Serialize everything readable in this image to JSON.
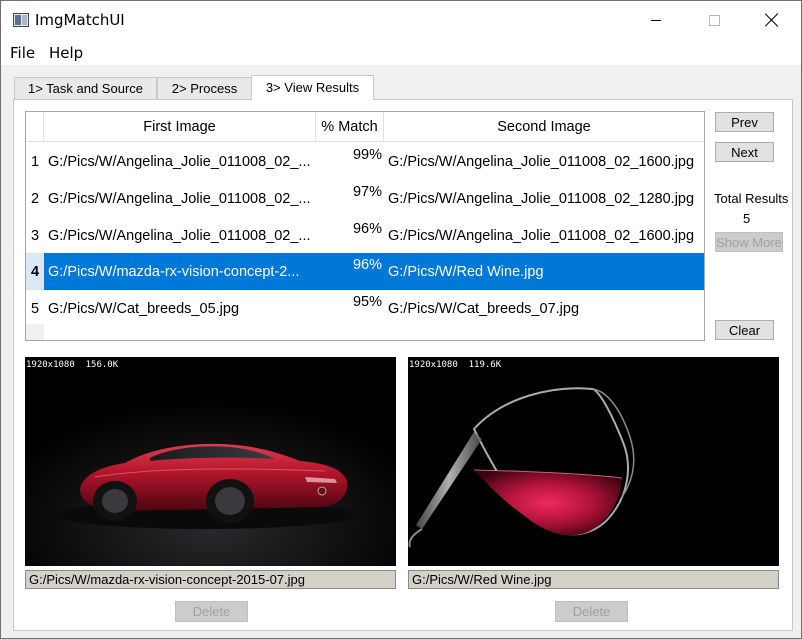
{
  "window": {
    "title": "ImgMatchUI"
  },
  "menu": {
    "file": "File",
    "help": "Help"
  },
  "tabs": [
    {
      "label": "1> Task and Source"
    },
    {
      "label": "2> Process"
    },
    {
      "label": "3> View Results"
    }
  ],
  "table": {
    "headers": {
      "first": "First Image",
      "match": "% Match",
      "second": "Second Image"
    },
    "selected_index": 4,
    "rows": [
      {
        "index": "1",
        "first": "G:/Pics/W/Angelina_Jolie_011008_02_...",
        "match": "99%",
        "second": "G:/Pics/W/Angelina_Jolie_011008_02_1600.jpg"
      },
      {
        "index": "2",
        "first": "G:/Pics/W/Angelina_Jolie_011008_02_...",
        "match": "97%",
        "second": "G:/Pics/W/Angelina_Jolie_011008_02_1280.jpg"
      },
      {
        "index": "3",
        "first": "G:/Pics/W/Angelina_Jolie_011008_02_...",
        "match": "96%",
        "second": "G:/Pics/W/Angelina_Jolie_011008_02_1600.jpg"
      },
      {
        "index": "4",
        "first": "G:/Pics/W/mazda-rx-vision-concept-2...",
        "match": "96%",
        "second": "G:/Pics/W/Red Wine.jpg"
      },
      {
        "index": "5",
        "first": "G:/Pics/W/Cat_breeds_05.jpg",
        "match": "95%",
        "second": "G:/Pics/W/Cat_breeds_07.jpg"
      }
    ]
  },
  "sidebar": {
    "prev": "Prev",
    "next": "Next",
    "total_label": "Total Results",
    "total_value": "5",
    "show_more": "Show More",
    "clear": "Clear"
  },
  "preview_left": {
    "info": "1920x1080  156.0K",
    "path": "G:/Pics/W/mazda-rx-vision-concept-2015-07.jpg",
    "delete": "Delete"
  },
  "preview_right": {
    "info": "1920x1080  119.6K",
    "path": "G:/Pics/W/Red Wine.jpg",
    "delete": "Delete"
  },
  "colors": {
    "selection": "#0078d7",
    "car_body": "#b0142a",
    "wine": "#b1123a"
  }
}
